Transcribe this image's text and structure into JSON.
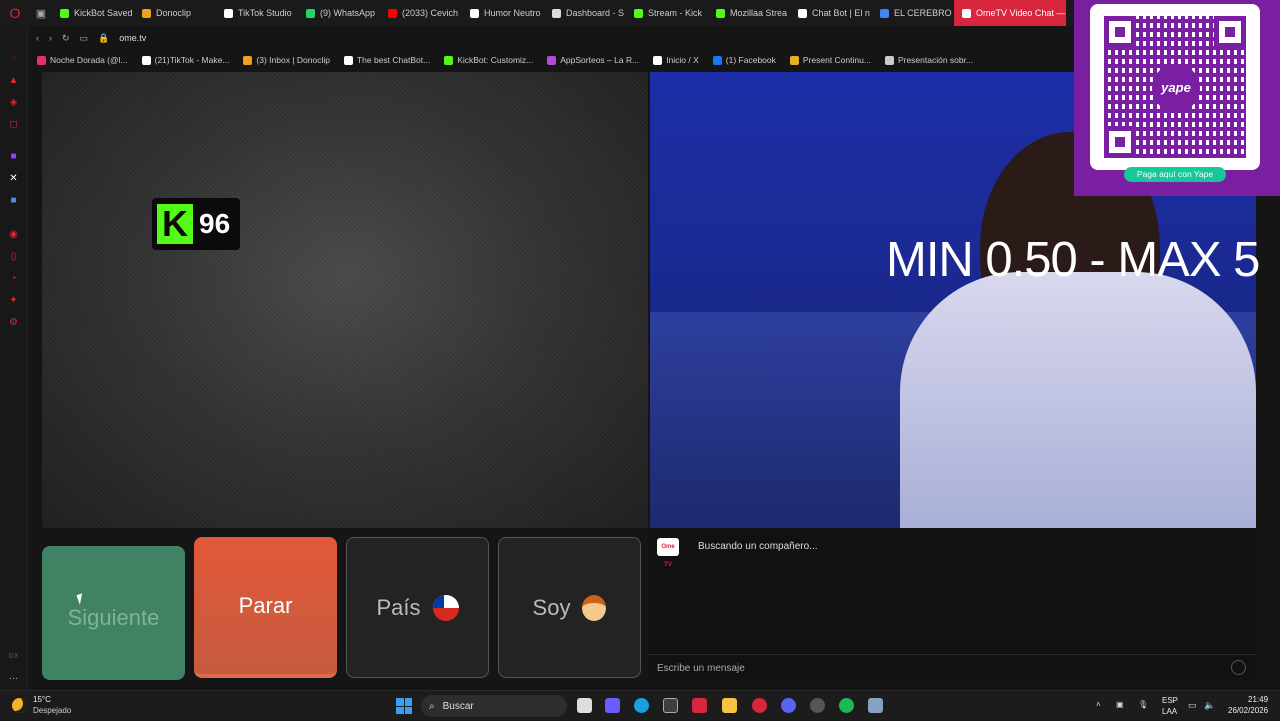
{
  "browser": {
    "url": "ome.tv",
    "tabs": [
      {
        "label": "KickBot Saved",
        "color": "#53fc18",
        "icon": "kick-icon"
      },
      {
        "label": "Donoclip",
        "color": "#f0a020",
        "icon": "donoclip-icon"
      },
      {
        "label": "TikTok Studio",
        "color": "#ffffff",
        "icon": "tiktok-icon"
      },
      {
        "label": "(9) WhatsApp",
        "color": "#25d366",
        "icon": "whatsapp-icon"
      },
      {
        "label": "(2033) Cevich",
        "color": "#ff0000",
        "icon": "youtube-icon"
      },
      {
        "label": "Humor Neutro",
        "color": "#ffffff",
        "icon": "tiktok-icon"
      },
      {
        "label": "Dashboard - S",
        "color": "#dddddd",
        "icon": "page-icon"
      },
      {
        "label": "Stream - Kick",
        "color": "#53fc18",
        "icon": "kick-icon"
      },
      {
        "label": "Mozillaa Strea",
        "color": "#53fc18",
        "icon": "kick-icon"
      },
      {
        "label": "Chat Bot | El n",
        "color": "#ffffff",
        "icon": "chatgpt-icon"
      },
      {
        "label": "EL CEREBRO F",
        "color": "#4285f4",
        "icon": "chrome-icon"
      },
      {
        "label": "OmeTV Video Chat — Or",
        "color": "#ffffff",
        "icon": "ometv-icon"
      }
    ],
    "bookmarks": [
      {
        "label": "Noche Dorada (@l...",
        "color": "#e1306c",
        "icon": "instagram-icon"
      },
      {
        "label": "(21)TikTok - Make...",
        "color": "#ffffff",
        "icon": "tiktok-icon"
      },
      {
        "label": "(3) Inbox | Donoclip",
        "color": "#f0a020",
        "icon": "donoclip-icon"
      },
      {
        "label": "The best ChatBot...",
        "color": "#ffffff",
        "icon": "chatbot-icon"
      },
      {
        "label": "KickBot: Customiz...",
        "color": "#53fc18",
        "icon": "kick-icon"
      },
      {
        "label": "AppSorteos – La R...",
        "color": "#b04cd6",
        "icon": "appsorteos-icon"
      },
      {
        "label": "Inicio / X",
        "color": "#ffffff",
        "icon": "x-icon"
      },
      {
        "label": "(1) Facebook",
        "color": "#1877f2",
        "icon": "facebook-icon"
      },
      {
        "label": "Present Continu...",
        "color": "#e8b020",
        "icon": "grid-icon"
      },
      {
        "label": "Presentación sobr...",
        "color": "#cccccc",
        "icon": "page-icon"
      }
    ]
  },
  "stream": {
    "kick_count": "96",
    "overlay_text": "MIN 0.50 - MAX 5",
    "qr_caption": "Paga aquí con Yape",
    "qr_logo": "yape"
  },
  "controls": {
    "next_label": "Siguiente",
    "stop_label": "Parar",
    "country_label": "País",
    "gender_label": "Soy"
  },
  "chat": {
    "logo_text": "Ome TV",
    "status": "Buscando un compañero...",
    "input_placeholder": "Escribe un mensaje"
  },
  "taskbar": {
    "temperature": "15°C",
    "weather": "Despejado",
    "search_label": "Buscar",
    "lang_code": "ESP",
    "lang_region": "LAA",
    "time": "21:49",
    "date": "26/02/2026"
  },
  "colors": {
    "kick_green": "#53fc18",
    "yape_purple": "#7b1fa2",
    "stop_orange": "#e2583a",
    "next_green": "#3f8264"
  }
}
